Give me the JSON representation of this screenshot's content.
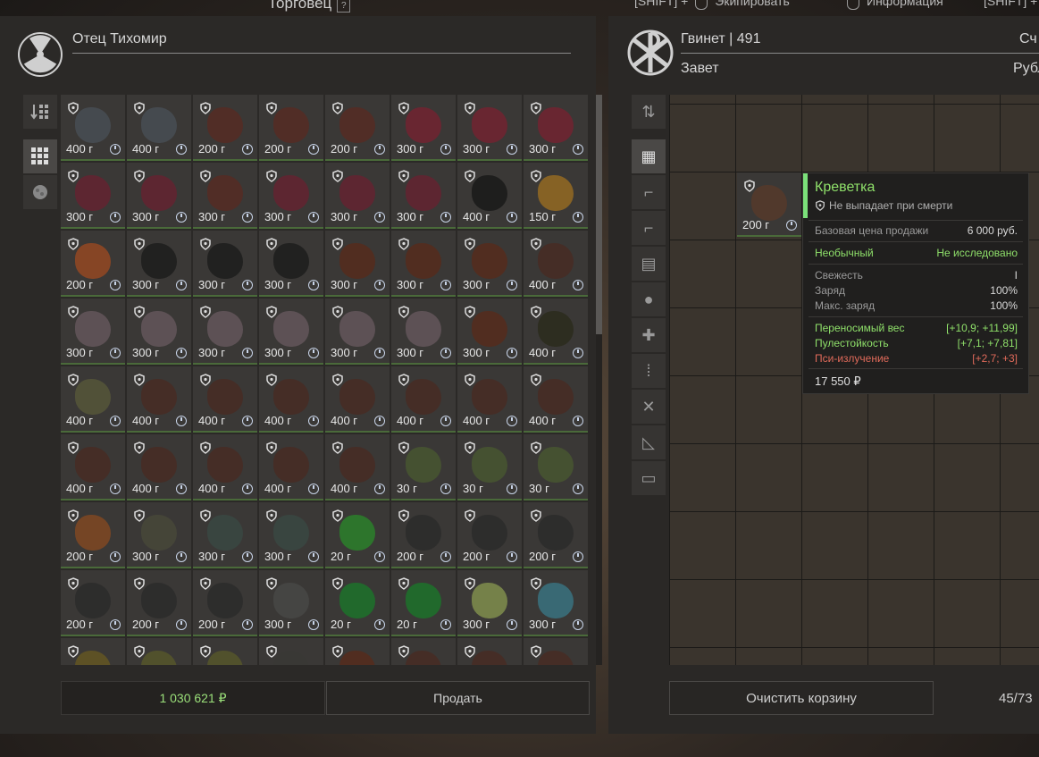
{
  "header": {
    "title": "Торговец",
    "help": "?",
    "hints": [
      {
        "key": "[SHIFT] +",
        "label": "Экипировать"
      },
      {
        "key": "",
        "label": "Информация"
      },
      {
        "key": "[SHIFT] +",
        "label": ""
      }
    ]
  },
  "trader": {
    "name": "Отец Тихомир",
    "balance": "1 030 621 ₽",
    "sell_label": "Продать",
    "tabs": [
      "sort-icon",
      "grid-icon",
      "artifact-icon"
    ]
  },
  "player": {
    "name": "Гвинет | 491",
    "faction": "Завет",
    "right_label": "Сч",
    "currency_label": "Рубл",
    "clear_label": "Очистить корзину",
    "weight": "45/73",
    "tabs": [
      "sort-icon",
      "grid-icon",
      "rifle-icon",
      "pistol-icon",
      "ammo-icon",
      "artifact-icon",
      "medkit-icon",
      "bullets-icon",
      "tools-icon",
      "misc-icon",
      "container-icon"
    ]
  },
  "grid_items": [
    {
      "price": "400 г",
      "color": "#4a5058"
    },
    {
      "price": "400 г",
      "color": "#4a5058"
    },
    {
      "price": "200 г",
      "color": "#5a2a22"
    },
    {
      "price": "200 г",
      "color": "#5a2a22"
    },
    {
      "price": "200 г",
      "color": "#5a2a22"
    },
    {
      "price": "300 г",
      "color": "#7a2030"
    },
    {
      "price": "300 г",
      "color": "#7a2030"
    },
    {
      "price": "300 г",
      "color": "#7a2030"
    },
    {
      "price": "300 г",
      "color": "#6a2030"
    },
    {
      "price": "300 г",
      "color": "#6a2030"
    },
    {
      "price": "300 г",
      "color": "#5a2a22"
    },
    {
      "price": "300 г",
      "color": "#6a2030"
    },
    {
      "price": "300 г",
      "color": "#6a2030"
    },
    {
      "price": "300 г",
      "color": "#6a2030"
    },
    {
      "price": "400 г",
      "color": "#151515"
    },
    {
      "price": "150 г",
      "color": "#a07020"
    },
    {
      "price": "200 г",
      "color": "#a04a20"
    },
    {
      "price": "300 г",
      "color": "#1a1a1a"
    },
    {
      "price": "300 г",
      "color": "#1a1a1a"
    },
    {
      "price": "300 г",
      "color": "#1a1a1a"
    },
    {
      "price": "300 г",
      "color": "#5a2a1a"
    },
    {
      "price": "300 г",
      "color": "#5a2a1a"
    },
    {
      "price": "300 г",
      "color": "#5a2a1a"
    },
    {
      "price": "400 г",
      "color": "#4a2a22"
    },
    {
      "price": "300 г",
      "color": "#6a5a60"
    },
    {
      "price": "300 г",
      "color": "#6a5a60"
    },
    {
      "price": "300 г",
      "color": "#6a5a60"
    },
    {
      "price": "300 г",
      "color": "#6a5a60"
    },
    {
      "price": "300 г",
      "color": "#6a5a60"
    },
    {
      "price": "300 г",
      "color": "#6a5a60"
    },
    {
      "price": "300 г",
      "color": "#5a2a1a"
    },
    {
      "price": "400 г",
      "color": "#2a2a1a"
    },
    {
      "price": "400 г",
      "color": "#5a5a3a"
    },
    {
      "price": "400 г",
      "color": "#4a2a22"
    },
    {
      "price": "400 г",
      "color": "#4a2a22"
    },
    {
      "price": "400 г",
      "color": "#4a2a22"
    },
    {
      "price": "400 г",
      "color": "#4a2a22"
    },
    {
      "price": "400 г",
      "color": "#4a2a22"
    },
    {
      "price": "400 г",
      "color": "#4a2a22"
    },
    {
      "price": "400 г",
      "color": "#4a2a22"
    },
    {
      "price": "400 г",
      "color": "#4a2a22"
    },
    {
      "price": "400 г",
      "color": "#4a2a22"
    },
    {
      "price": "400 г",
      "color": "#4a2a22"
    },
    {
      "price": "400 г",
      "color": "#4a2a22"
    },
    {
      "price": "400 г",
      "color": "#4a2a22"
    },
    {
      "price": "30 г",
      "color": "#4a5a30"
    },
    {
      "price": "30 г",
      "color": "#4a5a30"
    },
    {
      "price": "30 г",
      "color": "#4a5a30"
    },
    {
      "price": "200 г",
      "color": "#8a4a20"
    },
    {
      "price": "300 г",
      "color": "#4a4a3a"
    },
    {
      "price": "300 г",
      "color": "#3a4a44"
    },
    {
      "price": "300 г",
      "color": "#3a4a44"
    },
    {
      "price": "20 г",
      "color": "#2a8a2a"
    },
    {
      "price": "200 г",
      "color": "#2a2a2a"
    },
    {
      "price": "200 г",
      "color": "#2a2a2a"
    },
    {
      "price": "200 г",
      "color": "#2a2a2a"
    },
    {
      "price": "200 г",
      "color": "#2a2a2a"
    },
    {
      "price": "200 г",
      "color": "#2a2a2a"
    },
    {
      "price": "200 г",
      "color": "#2a2a2a"
    },
    {
      "price": "300 г",
      "color": "#4a4a48"
    },
    {
      "price": "20 г",
      "color": "#1a7a2a"
    },
    {
      "price": "20 г",
      "color": "#1a7a2a"
    },
    {
      "price": "300 г",
      "color": "#8a9a50"
    },
    {
      "price": "300 г",
      "color": "#3a7a8a"
    },
    {
      "price": "",
      "color": "#6a5a20"
    },
    {
      "price": "",
      "color": "#5a5a2a"
    },
    {
      "price": "",
      "color": "#5a5a2a"
    },
    {
      "price": "",
      "color": "#3a3836"
    },
    {
      "price": "",
      "color": "#5a2a1a"
    },
    {
      "price": "",
      "color": "#4a2a22"
    },
    {
      "price": "",
      "color": "#4a2a22"
    },
    {
      "price": "",
      "color": "#4a2a22"
    }
  ],
  "inventory_item": {
    "price": "200 г",
    "color": "#5a3a2a"
  },
  "tooltip": {
    "title": "Креветка",
    "subtitle": "Не выпадает при смерти",
    "base_price_label": "Базовая цена продажи",
    "base_price_value": "6 000 руб.",
    "rarity": "Необычный",
    "research": "Не исследовано",
    "stats": [
      {
        "label": "Свежесть",
        "value": "I"
      },
      {
        "label": "Заряд",
        "value": "100%"
      },
      {
        "label": "Макс. заряд",
        "value": "100%"
      }
    ],
    "effects": [
      {
        "label": "Переносимый вес",
        "value": "[+10,9; +11,99]",
        "kind": "good"
      },
      {
        "label": "Пулестойкость",
        "value": "[+7,1; +7,81]",
        "kind": "good"
      },
      {
        "label": "Пси-излучение",
        "value": "[+2,7; +3]",
        "kind": "bad"
      }
    ],
    "price": "17 550 ₽"
  }
}
